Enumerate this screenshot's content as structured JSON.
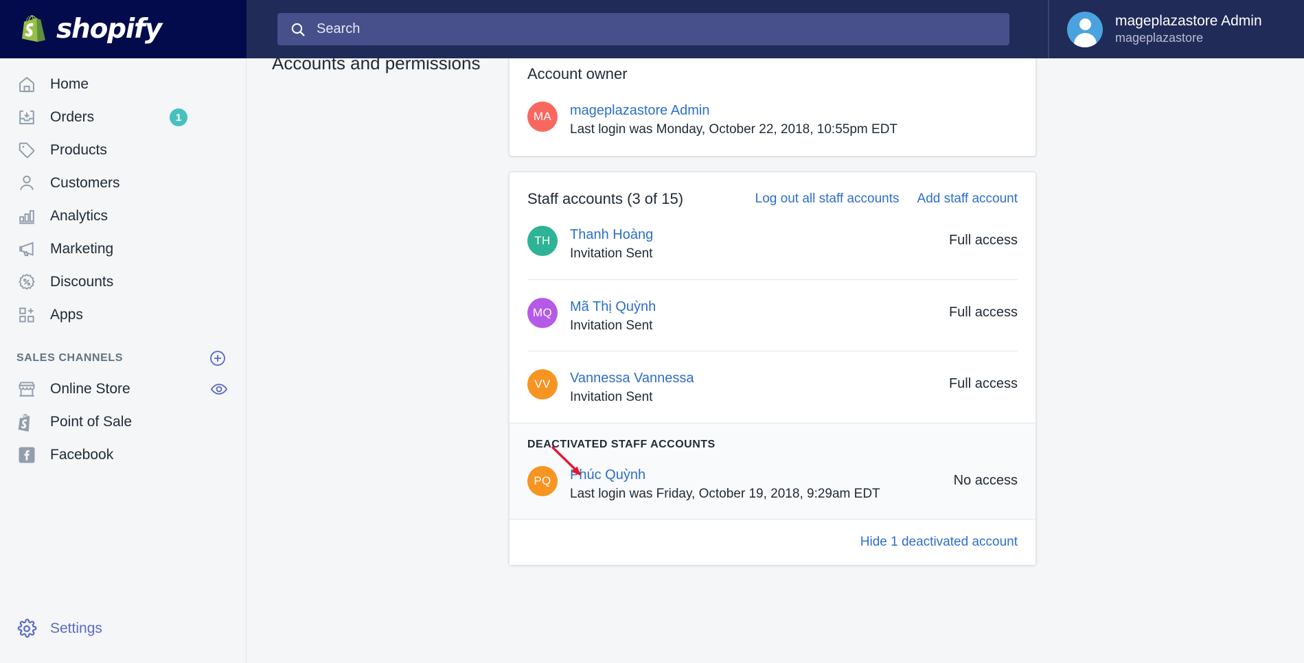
{
  "topbar": {
    "brand": "shopify",
    "brand_icon": "shopify-bag-logo",
    "search": {
      "icon": "search-icon",
      "placeholder": "Search",
      "value": ""
    },
    "user": {
      "avatar_icon": "user-avatar-icon",
      "name": "mageplazastore Admin",
      "store": "mageplazastore"
    },
    "bg_color": "#212b58",
    "logo_bg_color": "#030b4c"
  },
  "sidebar": {
    "items": [
      {
        "label": "Home",
        "icon": "home-icon",
        "badge": null
      },
      {
        "label": "Orders",
        "icon": "orders-inbox-icon",
        "badge": "1"
      },
      {
        "label": "Products",
        "icon": "products-tag-icon",
        "badge": null
      },
      {
        "label": "Customers",
        "icon": "customers-person-icon",
        "badge": null
      },
      {
        "label": "Analytics",
        "icon": "analytics-bar-chart-icon",
        "badge": null
      },
      {
        "label": "Marketing",
        "icon": "marketing-megaphone-icon",
        "badge": null
      },
      {
        "label": "Discounts",
        "icon": "discounts-percent-icon",
        "badge": null
      },
      {
        "label": "Apps",
        "icon": "apps-grid-plus-icon",
        "badge": null
      }
    ],
    "sales_channels": {
      "title": "SALES CHANNELS",
      "add_icon": "plus-circle-icon",
      "items": [
        {
          "label": "Online Store",
          "icon": "online-store-icon",
          "trailing_icon": "eye-icon"
        },
        {
          "label": "Point of Sale",
          "icon": "point-of-sale-icon",
          "trailing_icon": null
        },
        {
          "label": "Facebook",
          "icon": "facebook-icon",
          "trailing_icon": null
        }
      ]
    },
    "settings": {
      "label": "Settings",
      "icon": "gear-icon",
      "color": "#5c6ac4"
    },
    "badge_color": "#47c1bf"
  },
  "main": {
    "page_title": "Accounts and permissions",
    "account_owner": {
      "title": "Account owner",
      "initials": "MA",
      "avatar_color": "#f9685f",
      "name": "mageplazastore Admin",
      "last_login": "Last login was Monday, October 22, 2018, 10:55pm EDT"
    },
    "staff": {
      "title": "Staff accounts (3 of 15)",
      "actions": [
        {
          "label": "Log out all staff accounts",
          "name": "log-out-all-staff-accounts-link"
        },
        {
          "label": "Add staff account",
          "name": "add-staff-account-link"
        }
      ],
      "rows": [
        {
          "initials": "TH",
          "avatar_color": "#2eb396",
          "name": "Thanh Hoàng",
          "status": "Invitation Sent",
          "access": "Full access"
        },
        {
          "initials": "MQ",
          "avatar_color": "#b55ae8",
          "name": "Mã Thị Quỳnh",
          "status": "Invitation Sent",
          "access": "Full access"
        },
        {
          "initials": "VV",
          "avatar_color": "#f79522",
          "name": "Vannessa Vannessa",
          "status": "Invitation Sent",
          "access": "Full access"
        }
      ],
      "deactivated": {
        "title": "DEACTIVATED STAFF ACCOUNTS",
        "initials": "PQ",
        "avatar_color": "#f79522",
        "name": "Phúc Quỳnh",
        "last_login": "Last login was Friday, October 19, 2018, 9:29am EDT",
        "access": "No access"
      },
      "footer_link": "Hide 1 deactivated account"
    },
    "annotation": {
      "icon": "red-arrow-annotation",
      "color": "#e8142a"
    },
    "link_color": "#2c6ecb"
  }
}
